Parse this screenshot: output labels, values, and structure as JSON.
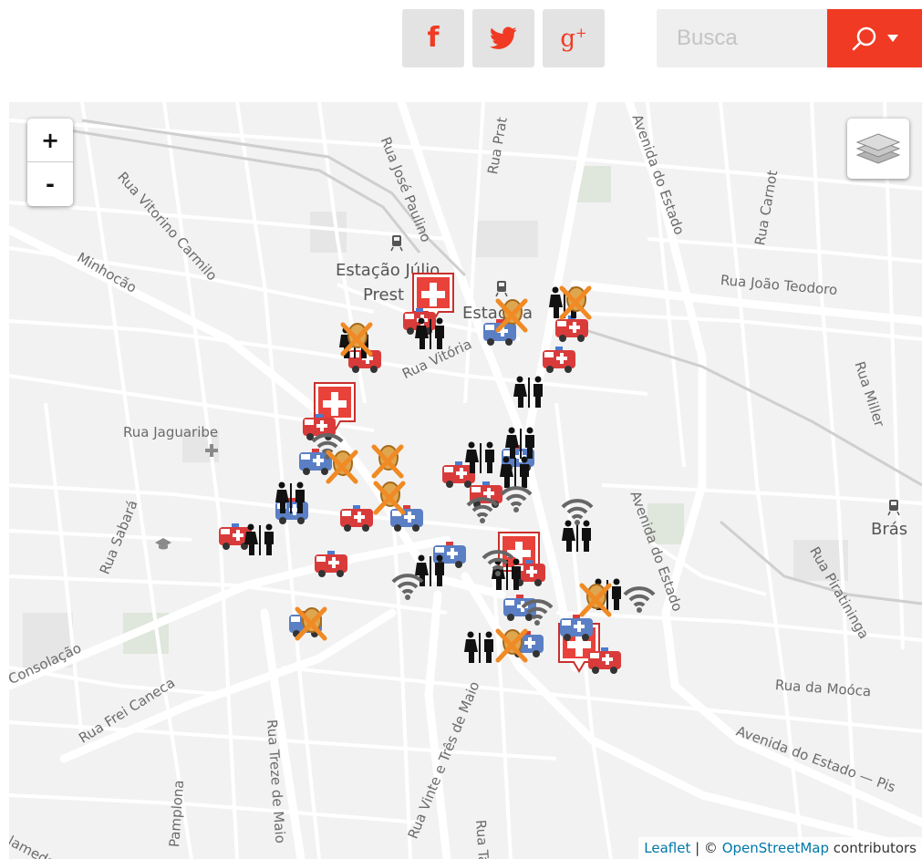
{
  "header": {
    "social": [
      {
        "network": "facebook",
        "glyph": "f"
      },
      {
        "network": "twitter",
        "glyph": "twitter-bird"
      },
      {
        "network": "google-plus",
        "glyph": "g+"
      }
    ],
    "search": {
      "placeholder": "Busca",
      "button_icon": "search-icon",
      "dropdown_icon": "caret-down-icon"
    },
    "accent_color": "#f03a23"
  },
  "map": {
    "zoom_in_label": "+",
    "zoom_out_label": "-",
    "layers_icon": "layers-icon",
    "places": {
      "estacao_julio": "Estação Júlio",
      "prestes": "Prest",
      "estacao_luz_fragment": "Estaçã",
      "luz_fragment": "a",
      "bras": "Brás"
    },
    "streets": {
      "rua_jose_paulino": "Rua José Paulino",
      "rua_prates": "Rua Prat",
      "avenida_do_estado_top": "Avenida do Estado",
      "rua_carnot": "Rua Carnot",
      "rua_vitorino_carmilo": "Rua Vitorino Carmilo",
      "minhocao": "Minhocão",
      "rua_joao_teodoro": "Rua João Teodoro",
      "rua_miller": "Rua Miller",
      "rua_vitoria": "Rua Vitória",
      "rua_jaguaribe": "Rua Jaguaribe",
      "rua_sabara": "Rua Sabará",
      "avenida_do_estado_mid": "Avenida do Estado",
      "rua_piratininga": "Rua Piratininga",
      "consolacao": "Consolação",
      "rua_frei_caneca": "Rua Frei Caneca",
      "rua_da_mooca": "Rua da Moóca",
      "avenida_do_estado_bottom": "Avenida do Estado — Pis",
      "rua_treze_de_maio": "Rua Treze de Maio",
      "rua_vinte_e_tres_de_maio": "Rua Vinte e Três de Maio",
      "rua_ta": "Rua Ta",
      "pamplona": "Pamplona",
      "alameda": "lameda"
    },
    "attribution": {
      "leaflet": "Leaflet",
      "separator": " | © ",
      "osm": "OpenStreetMap",
      "contributors": " contributors"
    },
    "marker_types": {
      "hospital": "hospital-marker",
      "ambulance_red": "ambulance-red-marker",
      "ambulance_blue": "ambulance-blue-marker",
      "restroom": "restroom-marker",
      "wifi": "wifi-marker",
      "no_food": "no-food-marker"
    },
    "colors": {
      "hospital": "#e8423a",
      "ambulance_red": "#d93b3b",
      "ambulance_blue": "#5b7fc4",
      "prohibited": "#f08a24",
      "wifi": "#666666"
    }
  }
}
